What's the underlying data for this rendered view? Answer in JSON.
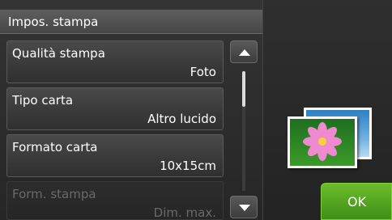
{
  "header": {
    "title": "Impos. stampa"
  },
  "menu": {
    "items": [
      {
        "label": "Qualità stampa",
        "value": "Foto",
        "enabled": true
      },
      {
        "label": "Tipo carta",
        "value": "Altro lucido",
        "enabled": true
      },
      {
        "label": "Formato carta",
        "value": "10x15cm",
        "enabled": true
      },
      {
        "label": "Form. stampa",
        "value": "Dim. max.",
        "enabled": false
      }
    ]
  },
  "scrollbar": {
    "position_fraction": 0.0
  },
  "preview": {
    "icon": "photo-stack-icon"
  },
  "buttons": {
    "ok_label": "OK"
  },
  "colors": {
    "ok_green": "#4fa21f",
    "header_gray": "#555555"
  }
}
